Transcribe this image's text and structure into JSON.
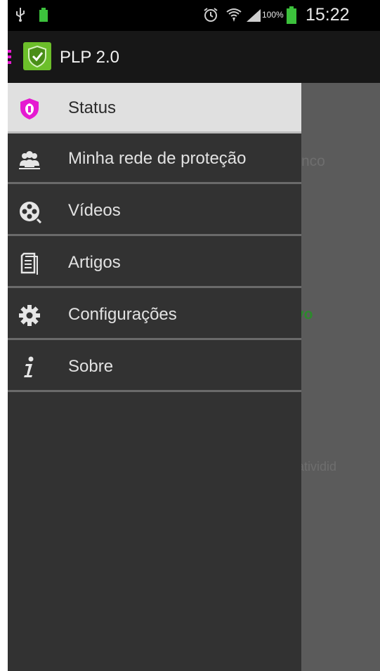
{
  "status_bar": {
    "battery_percent": "100%",
    "time": "15:22",
    "icons": [
      "usb-icon",
      "battery-notification-icon",
      "alarm-icon",
      "wifi-icon",
      "signal-icon",
      "battery-icon"
    ]
  },
  "action_bar": {
    "title": "PLP 2.0",
    "logo": "shield-check-icon"
  },
  "drawer": {
    "items": [
      {
        "label": "Status",
        "icon": "shield-icon",
        "active": true
      },
      {
        "label": "Minha rede de proteção",
        "icon": "people-icon",
        "active": false
      },
      {
        "label": "Vídeos",
        "icon": "film-reel-icon",
        "active": false
      },
      {
        "label": "Artigos",
        "icon": "document-icon",
        "active": false
      },
      {
        "label": "Configurações",
        "icon": "gear-icon",
        "active": false
      },
      {
        "label": "Sobre",
        "icon": "info-icon",
        "active": false
      }
    ]
  },
  "background_content": {
    "text_1": "nco",
    "text_2": "vo",
    "text_3": "atividid"
  },
  "colors": {
    "accent": "#e51ad1",
    "logo_green": "#6cbf2a",
    "active_status": "#2c8a2c"
  }
}
